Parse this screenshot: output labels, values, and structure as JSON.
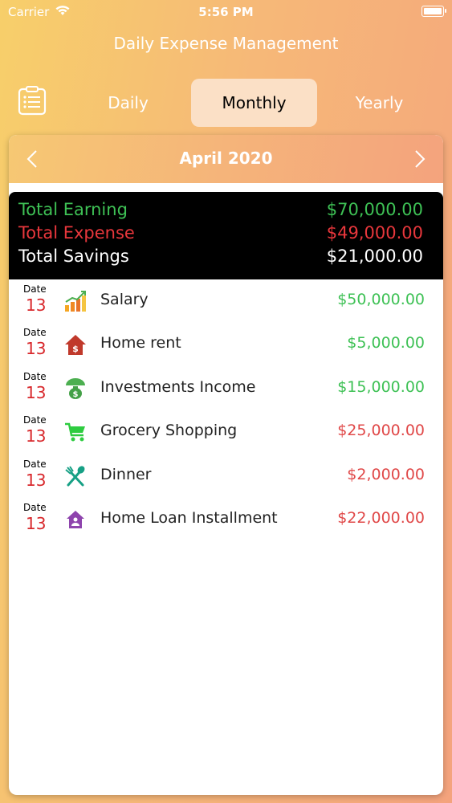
{
  "status": {
    "carrier": "Carrier",
    "time": "5:56 PM"
  },
  "app": {
    "title": "Daily Expense Management"
  },
  "tabs": [
    {
      "label": "Daily",
      "active": false
    },
    {
      "label": "Monthly",
      "active": true
    },
    {
      "label": "Yearly",
      "active": false
    }
  ],
  "period": {
    "label": "April 2020"
  },
  "summary": {
    "earning_label": "Total Earning",
    "earning_value": "$70,000.00",
    "expense_label": "Total Expense",
    "expense_value": "$49,000.00",
    "savings_label": "Total Savings",
    "savings_value": "$21,000.00"
  },
  "transactions": [
    {
      "date_label": "Date",
      "day": "13",
      "icon": "salary-chart-icon",
      "name": "Salary",
      "amount": "$50,000.00",
      "type": "income"
    },
    {
      "date_label": "Date",
      "day": "13",
      "icon": "home-rent-icon",
      "name": "Home rent",
      "amount": "$5,000.00",
      "type": "income"
    },
    {
      "date_label": "Date",
      "day": "13",
      "icon": "money-bag-umbrella-icon",
      "name": "Investments Income",
      "amount": "$15,000.00",
      "type": "income"
    },
    {
      "date_label": "Date",
      "day": "13",
      "icon": "shopping-cart-icon",
      "name": "Grocery Shopping",
      "amount": "$25,000.00",
      "type": "expense"
    },
    {
      "date_label": "Date",
      "day": "13",
      "icon": "fork-spoon-icon",
      "name": "Dinner",
      "amount": "$2,000.00",
      "type": "expense"
    },
    {
      "date_label": "Date",
      "day": "13",
      "icon": "home-loan-icon",
      "name": "Home Loan Installment",
      "amount": "$22,000.00",
      "type": "expense"
    }
  ],
  "colors": {
    "income": "#3ec155",
    "expense": "#e04848",
    "active_tab_bg": "#fbe0c6"
  }
}
